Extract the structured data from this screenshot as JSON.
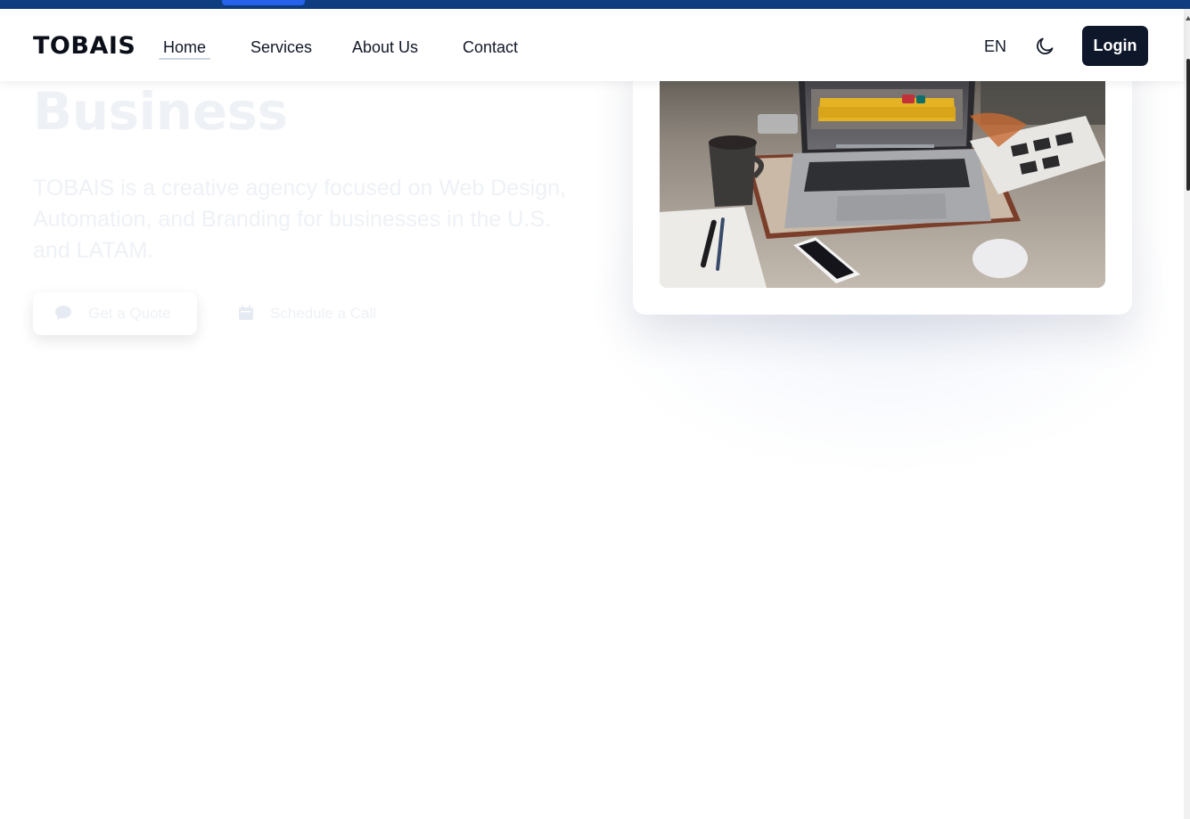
{
  "brand": {
    "logo_text": "TOBAIS"
  },
  "nav": {
    "items": [
      {
        "label": "Home",
        "active": true
      },
      {
        "label": "Services"
      },
      {
        "label": "About Us"
      },
      {
        "label": "Contact"
      }
    ],
    "language": "EN",
    "theme_icon": "moon-icon",
    "login_label": "Login"
  },
  "hero": {
    "title_visible": "Business",
    "description": "TOBAIS is a creative agency focused on Web Design, Automation, and Branding for businesses in the U.S. and LATAM.",
    "primary_button": {
      "label": "Get a Quote",
      "icon": "chat-bubble-icon"
    },
    "secondary_button": {
      "label": "Schedule a Call",
      "icon": "calendar-icon"
    },
    "image": {
      "icon": "laptop-desk-photo"
    }
  },
  "colors": {
    "top_strip": "#0f3d80",
    "top_strip_active": "#2563eb",
    "login_bg": "#0f172a",
    "text_dark": "#111827",
    "faded_text": "#eef1f6"
  }
}
